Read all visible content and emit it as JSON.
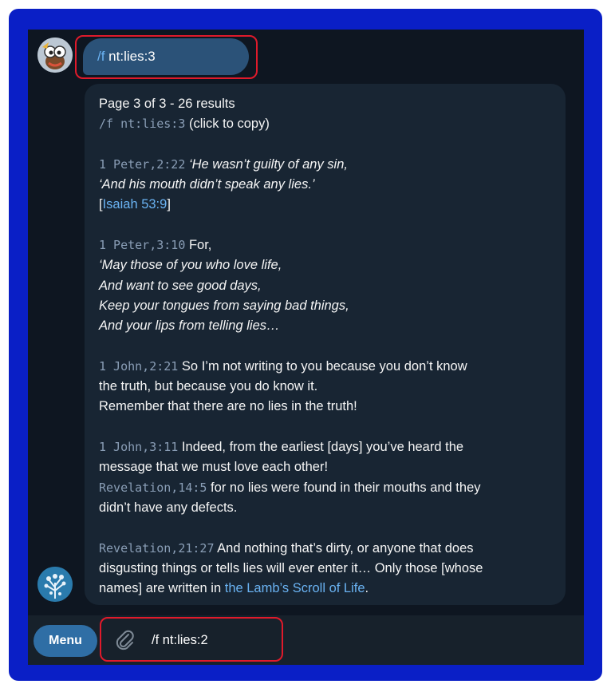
{
  "outgoing": {
    "command_prefix": "/f",
    "command_rest": " nt:lies:3"
  },
  "reply": {
    "header": "Page 3 of 3 - 26 results",
    "copy_cmd": "/f nt:lies:3",
    "copy_note": " (click to copy)",
    "entries": [
      {
        "ref": "1 Peter,2:22",
        "l1": " ‘He wasn’t guilty of any sin,",
        "l2": "‘And his mouth didn’t speak any lies.’",
        "xref_open": "[",
        "xref": "Isaiah 53:9",
        "xref_close": "]"
      },
      {
        "ref": "1 Peter,3:10",
        "l1": " For,",
        "l2": "‘May those of you who love life,",
        "l3": "And want to see good days,",
        "l4": "Keep your tongues from saying bad things,",
        "l5": "And your lips from telling lies…"
      },
      {
        "ref": "1 John,2:21",
        "l1": " So I’m not writing to you because you don’t know",
        "l2": "the truth, but because you do know it.",
        "l3": "Remember that there are no lies in the truth!"
      },
      {
        "ref": "1 John,3:11",
        "l1": " Indeed, from the earliest [days] you’ve heard the",
        "l2": "message that we must love each other!"
      },
      {
        "ref": "Revelation,14:5",
        "l1": " for no lies were found in their mouths and they",
        "l2": "didn’t have any defects."
      },
      {
        "ref": "Revelation,21:27",
        "l1": " And nothing that’s dirty, or anyone that does",
        "l2": "disgusting things or tells lies will ever enter it… Only those [whose",
        "l3": "names] are written in ",
        "link": "the Lamb’s Scroll of Life",
        "end": "."
      }
    ]
  },
  "input": {
    "menu_label": "Menu",
    "value": "/f nt:lies:2",
    "attach_icon": "paperclip-icon"
  },
  "colors": {
    "frame": "#0a1fc6",
    "highlight": "#e01a2b",
    "outgoing_bubble": "#2b5278",
    "incoming_bubble": "#182533",
    "link": "#6ab3f3"
  }
}
